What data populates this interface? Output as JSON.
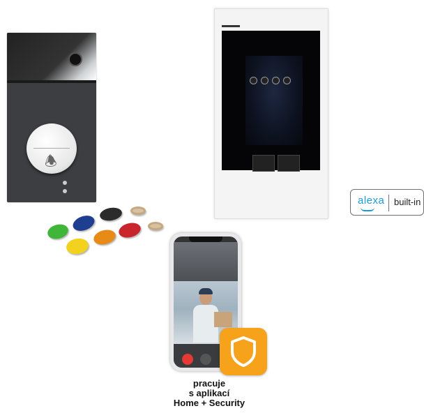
{
  "caption": {
    "line1": "pracuje",
    "line2": "s aplikací",
    "line3": "Home + Security"
  },
  "alexa_badge": {
    "brand": "alexa",
    "suffix": "built-in",
    "brand_color": "#1d9bd6"
  },
  "icons": {
    "door_button": "bell-icon",
    "app": "shield-icon"
  },
  "colors": {
    "app_icon": "#f7a21b",
    "tags": [
      "#3fb53a",
      "#1e3f8f",
      "#2b2b2b",
      "#d8c2a3",
      "#e88a16",
      "#c9252d",
      "#f2d21c",
      "#d9c0a0"
    ]
  }
}
